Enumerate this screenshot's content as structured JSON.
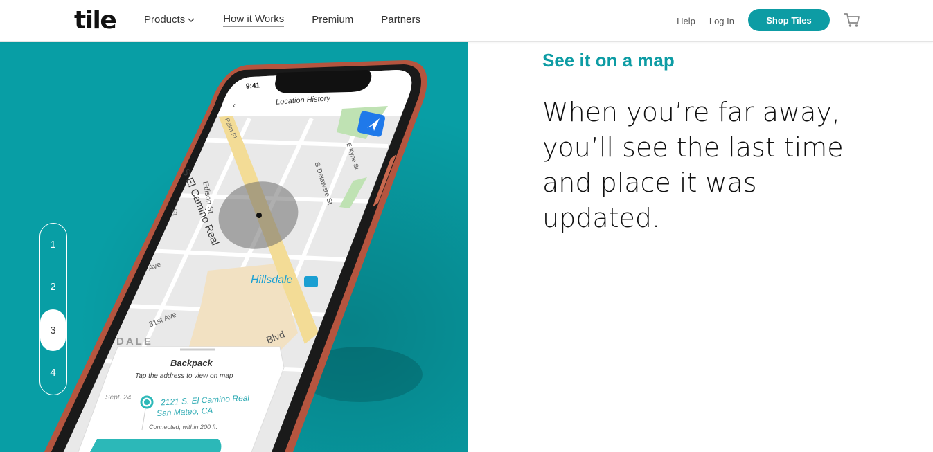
{
  "header": {
    "logo": "tile",
    "nav": [
      {
        "label": "Products",
        "has_dropdown": true
      },
      {
        "label": "How it Works",
        "active": true
      },
      {
        "label": "Premium"
      },
      {
        "label": "Partners"
      }
    ],
    "help": "Help",
    "login": "Log In",
    "shop_button": "Shop Tiles",
    "cart_icon": "cart-icon"
  },
  "steps": [
    "1",
    "2",
    "3",
    "4"
  ],
  "active_step": "3",
  "phone": {
    "time": "9:41",
    "screen_title": "Location History",
    "streets": {
      "camino": "S El Camino Real",
      "palm": "Palm Pl",
      "edison": "Edison St",
      "delaware": "S Delaware St",
      "kyne": "E Kyne St",
      "ave1": "Ave",
      "ave31": "31st Ave",
      "blvd": "Blvd",
      "dale": "DALE",
      "st": "St",
      "hillsdale": "Hillsdale"
    },
    "card": {
      "title": "Backpack",
      "subtitle": "Tap the address to view on map",
      "date": "Sept. 24",
      "address1": "2121 S. El Camino Real",
      "address2": "San Mateo, CA",
      "status": "Connected, within 200 ft."
    }
  },
  "content": {
    "kicker": "See it on a map",
    "headline": "When you’re far away, you’ll see the last time and place it was updated."
  },
  "colors": {
    "brand_teal": "#0d9ca4",
    "hero_bg": "#089ea5",
    "phone_frame": "#b5553f"
  }
}
